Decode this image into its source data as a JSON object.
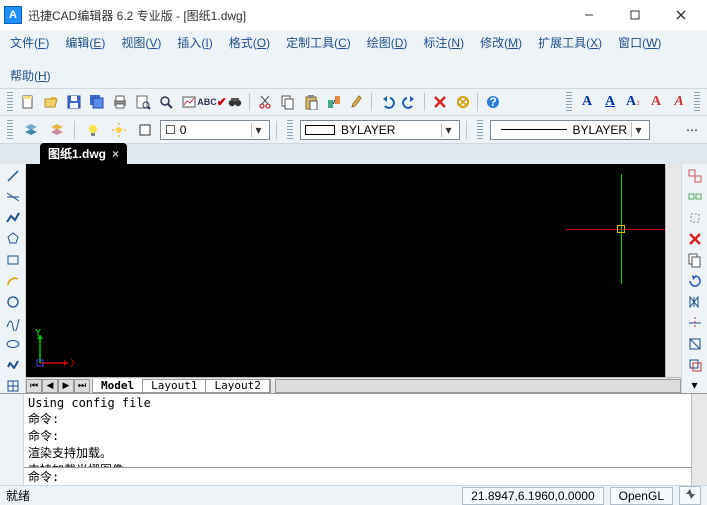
{
  "title": "迅捷CAD编辑器 6.2 专业版  - [图纸1.dwg]",
  "menus": [
    {
      "label": "文件",
      "hk": "F"
    },
    {
      "label": "编辑",
      "hk": "E"
    },
    {
      "label": "视图",
      "hk": "V"
    },
    {
      "label": "插入",
      "hk": "I"
    },
    {
      "label": "格式",
      "hk": "O"
    },
    {
      "label": "定制工具",
      "hk": "C"
    },
    {
      "label": "绘图",
      "hk": "D"
    },
    {
      "label": "标注",
      "hk": "N"
    },
    {
      "label": "修改",
      "hk": "M"
    },
    {
      "label": "扩展工具",
      "hk": "X"
    },
    {
      "label": "窗口",
      "hk": "W"
    },
    {
      "label": "帮助",
      "hk": "H"
    }
  ],
  "doc_tab": {
    "label": "图纸1.dwg"
  },
  "layer": {
    "current": "0",
    "linetype": "BYLAYER",
    "lineweight": "BYLAYER"
  },
  "layout_tabs": [
    "Model",
    "Layout1",
    "Layout2"
  ],
  "cmd_log": [
    "Using config file",
    "命令:",
    "命令:",
    "渲染支持加载。",
    "支持加载光栅图像。"
  ],
  "cmd_prompt": "命令:",
  "status": {
    "ready": "就绪",
    "coords": "21.8947,6.1960,0.0000",
    "render": "OpenGL"
  },
  "icons": {
    "new": "new-icon",
    "open": "open-icon",
    "save": "save-icon",
    "saveall": "saveall-icon",
    "print": "print-icon",
    "preview": "preview-icon",
    "find": "find-icon",
    "plot": "plot-icon",
    "spell": "spell-icon",
    "binoc": "binoc-icon",
    "cut": "cut-icon",
    "copy": "copy-icon",
    "paste": "paste-icon",
    "matchprop": "matchprop-icon",
    "brush": "brush-icon",
    "undo": "undo-icon",
    "redo": "redo-icon",
    "delete": "delete-icon",
    "purge": "purge-icon",
    "help": "help-icon",
    "textA": "text-a-icon",
    "textAu": "text-au-icon",
    "textAh": "text-ah-icon",
    "textSingle": "text-single-icon",
    "textMulti": "text-multi-icon",
    "layers": "layers-icon",
    "layeriso": "layer-iso-icon",
    "bulb": "bulb-icon",
    "sun": "sun-icon",
    "line": "line-tool-icon",
    "xline": "xline-icon",
    "pline": "pline-icon",
    "polygon": "polygon-icon",
    "rect": "rect-icon",
    "arc": "arc-icon",
    "circle": "circle-icon",
    "spline": "spline-icon",
    "ellipse": "ellipse-icon",
    "revcloud": "revcloud-icon",
    "insert": "insert-icon",
    "group": "group-icon",
    "ungroup": "ungroup-icon",
    "explode": "explode-icon",
    "deleteR": "delete-r-icon",
    "copyR": "copyclip-icon",
    "rotateR": "rotate-icon",
    "mirror": "mirror-icon",
    "trim": "trim-icon",
    "extend": "extend-icon"
  }
}
